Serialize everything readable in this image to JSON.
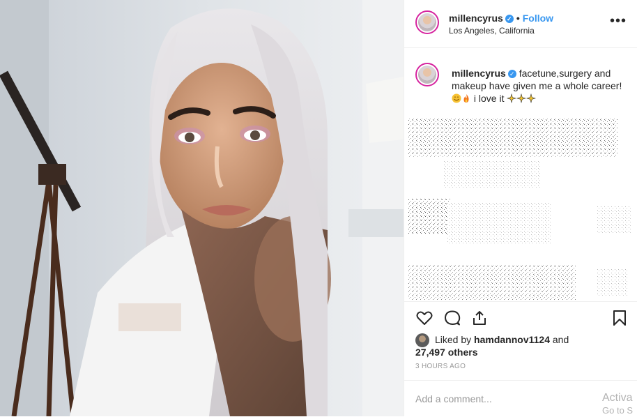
{
  "post": {
    "username": "millencyrus",
    "follow_label": "Follow",
    "separator": "•",
    "verified_glyph": "✓",
    "location": "Los Angeles, California",
    "more_glyph": "•••",
    "caption": {
      "username": "millencyrus",
      "text_before": "facetune,surgery and makeup have given me a whole career!",
      "text_after": " i love it"
    },
    "likes": {
      "prefix": "Liked by ",
      "user": "hamdannov1124",
      "middle": " and",
      "count": "27,497 others"
    },
    "timestamp": "3 HOURS AGO",
    "comment_placeholder": "Add a comment..."
  },
  "icons": {
    "like": "heart-icon",
    "comment": "comment-icon",
    "share": "share-icon",
    "save": "bookmark-icon",
    "emoji_1": "smiling-face-emoji",
    "emoji_2": "fire-emoji",
    "emoji_3": "sparkles-emoji"
  },
  "colors": {
    "link_blue": "#3897f0",
    "text": "#262626",
    "muted": "#999999",
    "story_ring": "#d6249f"
  },
  "overlay": {
    "line1": "Activa",
    "line2": "Go to S"
  }
}
